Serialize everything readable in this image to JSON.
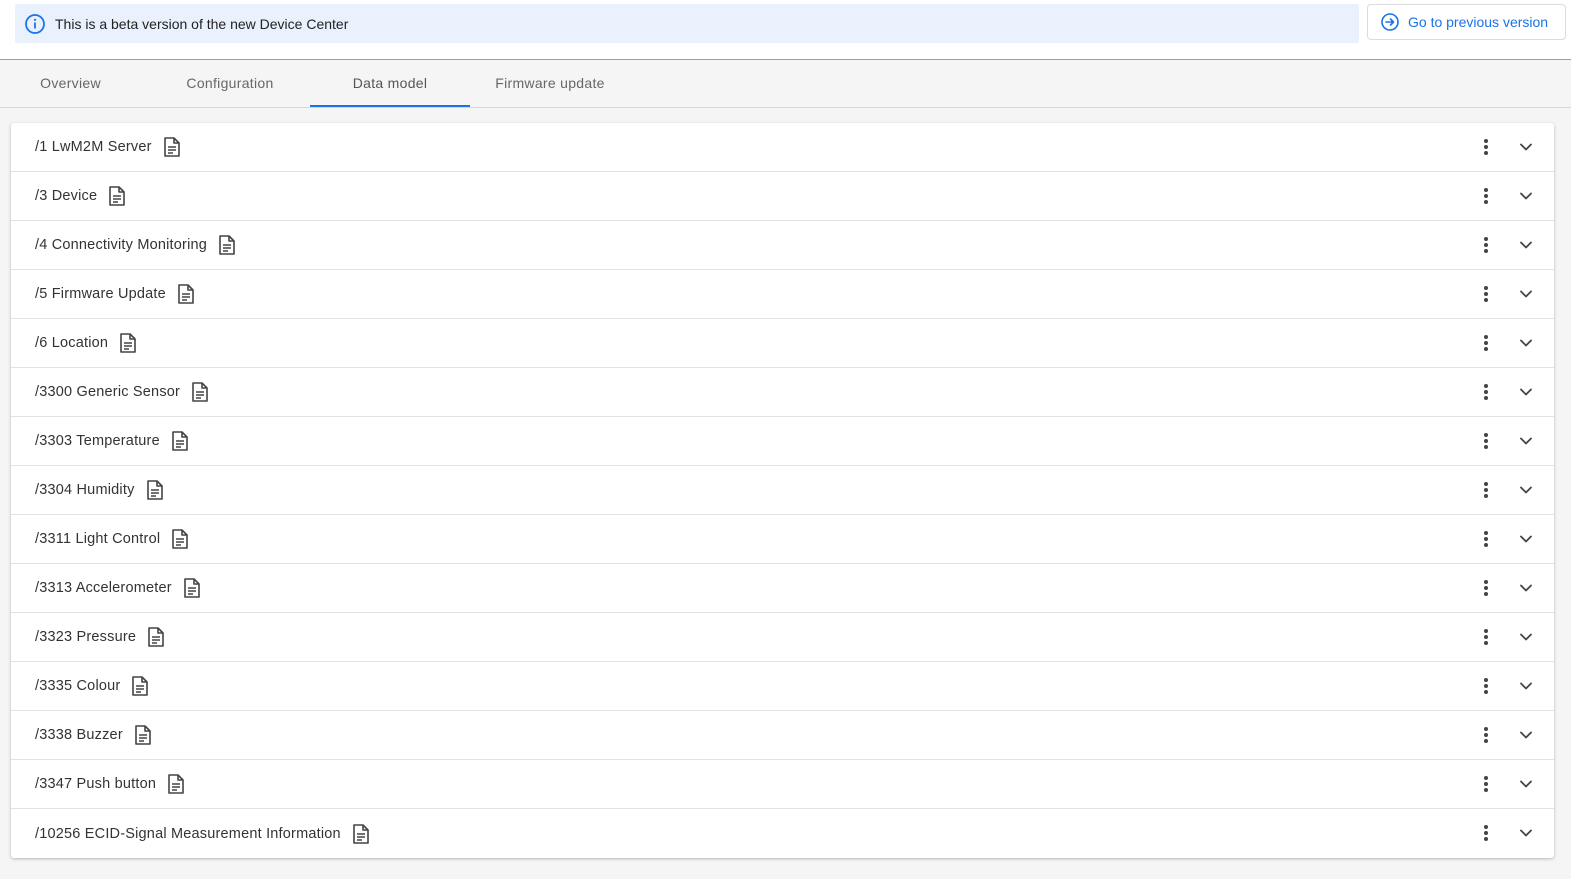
{
  "banner": {
    "message": "This is a beta version of the new Device Center",
    "icon": "info-icon",
    "accent_color": "#1a73e8",
    "background_color": "#e9f1fd"
  },
  "prev_version_button": {
    "label": "Go to previous version",
    "icon": "arrow-right-circle-icon"
  },
  "tabs": [
    {
      "label": "Overview",
      "active": false
    },
    {
      "label": "Configuration",
      "active": false
    },
    {
      "label": "Data model",
      "active": true
    },
    {
      "label": "Firmware update",
      "active": false
    }
  ],
  "objects": [
    {
      "label": "/1 LwM2M Server"
    },
    {
      "label": "/3 Device"
    },
    {
      "label": "/4 Connectivity Monitoring"
    },
    {
      "label": "/5 Firmware Update"
    },
    {
      "label": "/6 Location"
    },
    {
      "label": "/3300 Generic Sensor"
    },
    {
      "label": "/3303 Temperature"
    },
    {
      "label": "/3304 Humidity"
    },
    {
      "label": "/3311 Light Control"
    },
    {
      "label": "/3313 Accelerometer"
    },
    {
      "label": "/3323 Pressure"
    },
    {
      "label": "/3335 Colour"
    },
    {
      "label": "/3338 Buzzer"
    },
    {
      "label": "/3347 Push button"
    },
    {
      "label": "/10256 ECID-Signal Measurement Information"
    }
  ],
  "row_icons": {
    "doc": "document-icon",
    "menu": "more-vert-icon",
    "expand": "chevron-down-icon"
  }
}
